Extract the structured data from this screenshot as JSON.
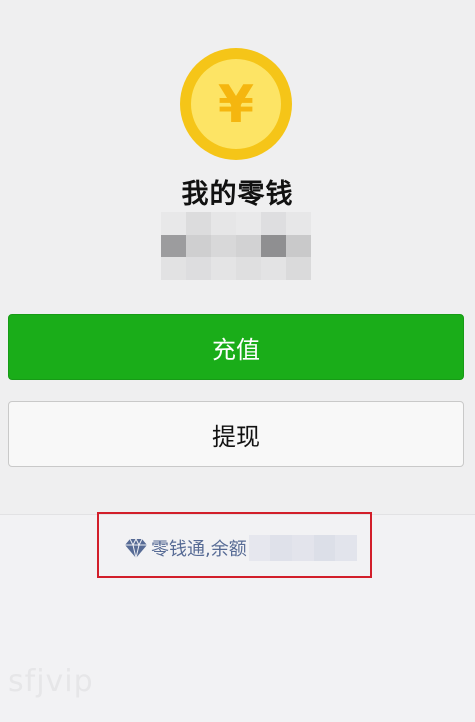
{
  "wallet": {
    "title": "我的零钱",
    "coin_symbol": "¥",
    "balance_obscured": true,
    "colors": {
      "coin_outer": "#f5c518",
      "coin_inner": "#fde465",
      "coin_symbol": "#f5b60f"
    }
  },
  "actions": {
    "recharge_label": "充值",
    "withdraw_label": "提现",
    "recharge_color": "#1aad19"
  },
  "lingqiantong": {
    "icon": "diamond-icon",
    "label": "零钱通,余额",
    "amount_obscured": true,
    "link_color": "#576b95"
  },
  "annotation": {
    "highlight_color": "#d21e2a"
  },
  "watermark": "sfjvip"
}
